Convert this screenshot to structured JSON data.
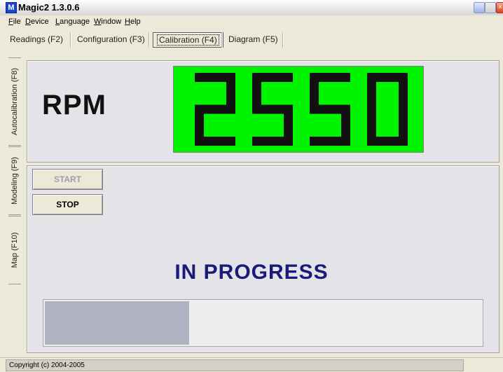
{
  "window": {
    "title": "Magic2 1.3.0.6",
    "app_icon": "M"
  },
  "menu": [
    {
      "label": "File",
      "underline": "F",
      "rest": "ile"
    },
    {
      "label": "Device",
      "underline": "D",
      "rest": "evice"
    },
    {
      "label": "Language",
      "underline": "L",
      "rest": "anguage"
    },
    {
      "label": "Window",
      "underline": "W",
      "rest": "indow"
    },
    {
      "label": "Help",
      "underline": "H",
      "rest": "elp"
    }
  ],
  "tabs": [
    "Readings (F2)",
    "Configuration (F3)",
    "Calibration (F4)",
    "Diagram (F5)"
  ],
  "active_tab": "Calibration (F4)",
  "side_tabs": [
    "Autocalibration (F8)",
    "Modeling (F9)",
    "Map (F10)"
  ],
  "rpm": {
    "label": "RPM",
    "value": "2550",
    "display_color": "#00f400"
  },
  "buttons": {
    "start": "START",
    "stop": "STOP"
  },
  "status": "IN PROGRESS",
  "progress": {
    "value": 0.33
  },
  "statusbar": {
    "copyright": "Copyright (c) 2004-2005"
  }
}
